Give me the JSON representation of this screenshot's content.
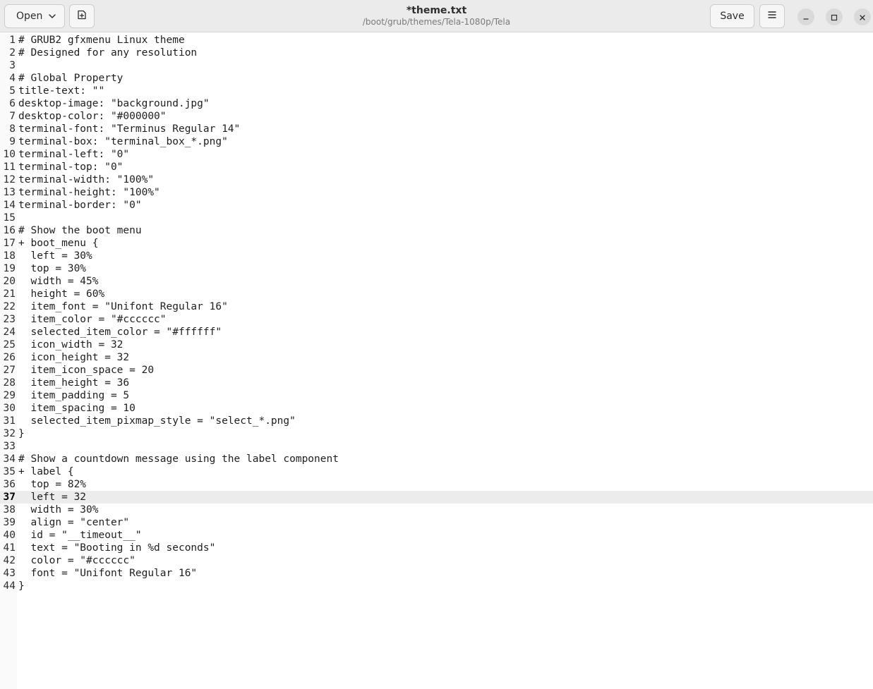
{
  "window": {
    "title": "*theme.txt",
    "subtitle": "/boot/grub/themes/Tela-1080p/Tela"
  },
  "header": {
    "open_label": "Open",
    "save_label": "Save",
    "icons": {
      "open_dropdown": "chevron-down-icon",
      "new_document": "new-document-icon",
      "menu": "hamburger-menu-icon",
      "minimize": "minimize-icon",
      "maximize": "maximize-icon",
      "close": "close-icon"
    }
  },
  "editor": {
    "current_line": 37,
    "colors": {
      "current_line_bg": "#ececec",
      "gutter_bg": "#fafafa",
      "header_bg": "#ebebeb"
    },
    "lines": [
      {
        "n": "1",
        "text": "# GRUB2 gfxmenu Linux theme"
      },
      {
        "n": "2",
        "text": "# Designed for any resolution"
      },
      {
        "n": "3",
        "text": ""
      },
      {
        "n": "4",
        "text": "# Global Property"
      },
      {
        "n": "5",
        "text": "title-text: \"\""
      },
      {
        "n": "6",
        "text": "desktop-image: \"background.jpg\""
      },
      {
        "n": "7",
        "text": "desktop-color: \"#000000\""
      },
      {
        "n": "8",
        "text": "terminal-font: \"Terminus Regular 14\""
      },
      {
        "n": "9",
        "text": "terminal-box: \"terminal_box_*.png\""
      },
      {
        "n": "10",
        "text": "terminal-left: \"0\""
      },
      {
        "n": "11",
        "text": "terminal-top: \"0\""
      },
      {
        "n": "12",
        "text": "terminal-width: \"100%\""
      },
      {
        "n": "13",
        "text": "terminal-height: \"100%\""
      },
      {
        "n": "14",
        "text": "terminal-border: \"0\""
      },
      {
        "n": "15",
        "text": ""
      },
      {
        "n": "16",
        "text": "# Show the boot menu"
      },
      {
        "n": "17",
        "text": "+ boot_menu {"
      },
      {
        "n": "18",
        "text": "  left = 30%"
      },
      {
        "n": "19",
        "text": "  top = 30%"
      },
      {
        "n": "20",
        "text": "  width = 45%"
      },
      {
        "n": "21",
        "text": "  height = 60%"
      },
      {
        "n": "22",
        "text": "  item_font = \"Unifont Regular 16\""
      },
      {
        "n": "23",
        "text": "  item_color = \"#cccccc\""
      },
      {
        "n": "24",
        "text": "  selected_item_color = \"#ffffff\""
      },
      {
        "n": "25",
        "text": "  icon_width = 32"
      },
      {
        "n": "26",
        "text": "  icon_height = 32"
      },
      {
        "n": "27",
        "text": "  item_icon_space = 20"
      },
      {
        "n": "28",
        "text": "  item_height = 36"
      },
      {
        "n": "29",
        "text": "  item_padding = 5"
      },
      {
        "n": "30",
        "text": "  item_spacing = 10"
      },
      {
        "n": "31",
        "text": "  selected_item_pixmap_style = \"select_*.png\""
      },
      {
        "n": "32",
        "text": "}"
      },
      {
        "n": "33",
        "text": ""
      },
      {
        "n": "34",
        "text": "# Show a countdown message using the label component"
      },
      {
        "n": "35",
        "text": "+ label {"
      },
      {
        "n": "36",
        "text": "  top = 82%"
      },
      {
        "n": "37",
        "text": "  left = 32"
      },
      {
        "n": "38",
        "text": "  width = 30%"
      },
      {
        "n": "39",
        "text": "  align = \"center\""
      },
      {
        "n": "40",
        "text": "  id = \"__timeout__\""
      },
      {
        "n": "41",
        "text": "  text = \"Booting in %d seconds\""
      },
      {
        "n": "42",
        "text": "  color = \"#cccccc\""
      },
      {
        "n": "43",
        "text": "  font = \"Unifont Regular 16\""
      },
      {
        "n": "44",
        "text": "}"
      }
    ]
  }
}
